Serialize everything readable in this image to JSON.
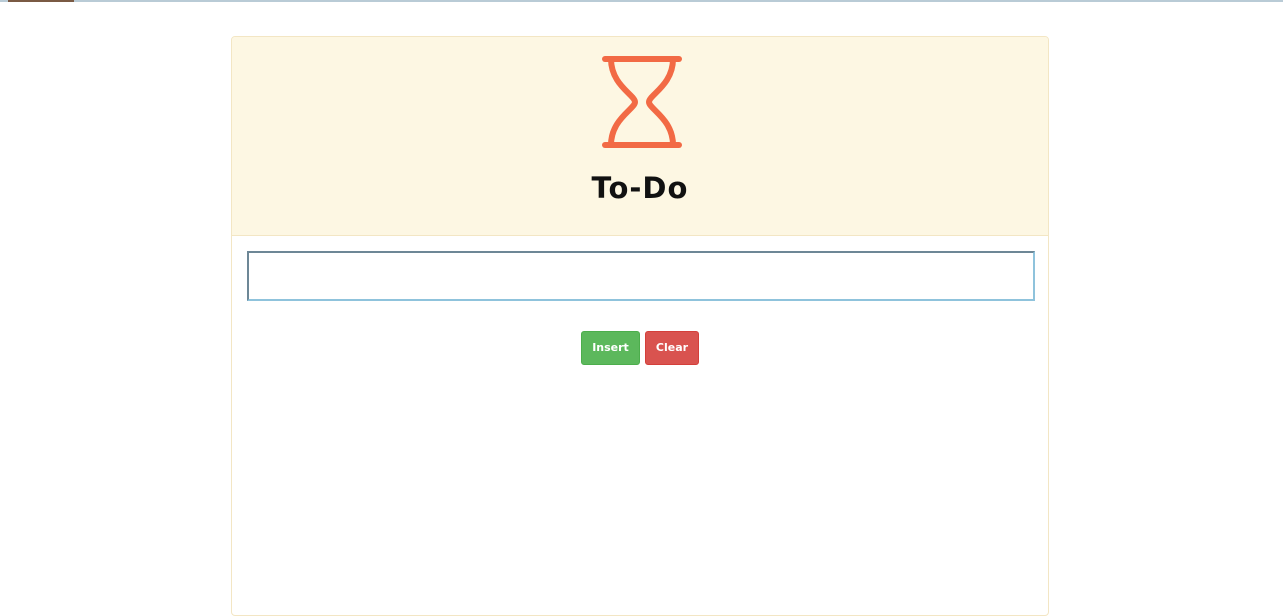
{
  "header": {
    "icon": "hourglass-icon",
    "title": "To-Do"
  },
  "input": {
    "value": "",
    "placeholder": ""
  },
  "actions": {
    "insert_label": "Insert",
    "clear_label": "Clear"
  },
  "colors": {
    "header_background": "#fdf7e3",
    "icon": "#f26a45",
    "insert_button": "#5cb85c",
    "clear_button": "#d9534f"
  }
}
